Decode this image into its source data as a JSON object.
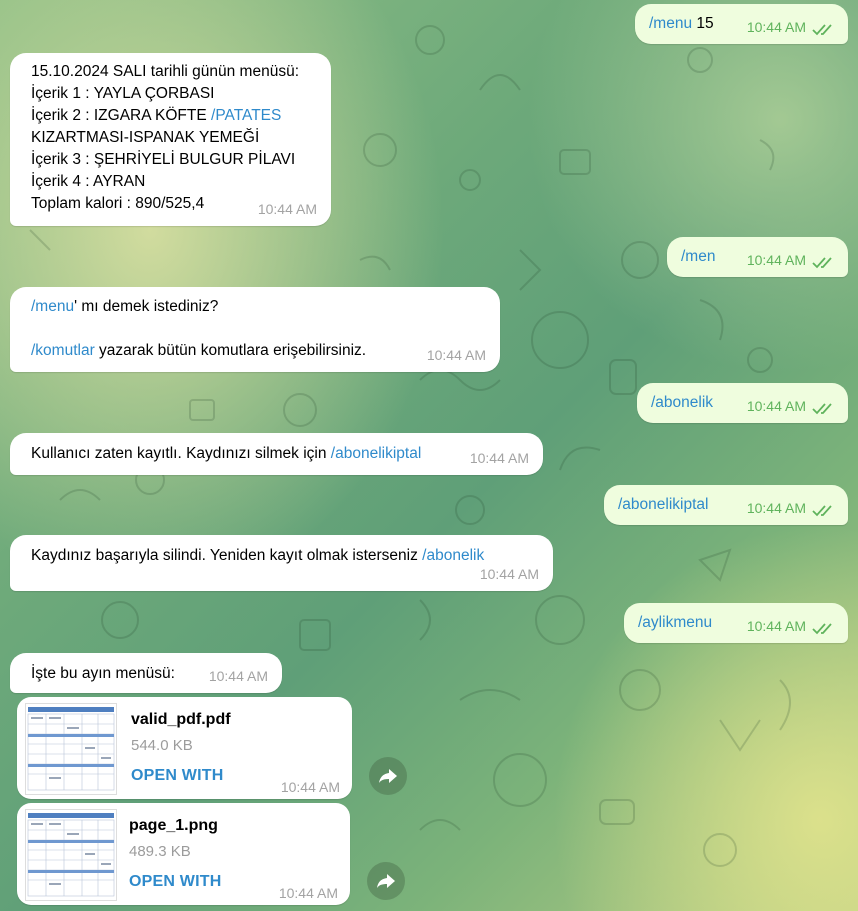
{
  "colors": {
    "link": "#2f8acb",
    "outgoing_bubble": "#effdde",
    "incoming_bubble": "#ffffff",
    "read_ticks": "#5fb35c"
  },
  "messages": [
    {
      "dir": "out",
      "cmd": "/menu",
      "rest": " 15",
      "time": "10:44 AM"
    },
    {
      "dir": "in",
      "lines": [
        "15.10.2024 SALI tarihli günün menüsü:",
        "İçerik 1 : YAYLA ÇORBASI"
      ],
      "line3a": "İçerik 2 : IZGARA KÖFTE ",
      "line3link": "/PATATES",
      "lines2": [
        "KIZARTMASI-ISPANAK YEMEĞİ",
        "İçerik 3 : ŞEHRİYELİ BULGUR PİLAVI",
        "İçerik 4 : AYRAN"
      ],
      "last": "Toplam kalori : 890/525,4",
      "time": "10:44 AM"
    },
    {
      "dir": "out",
      "cmd": "/men",
      "time": "10:44 AM"
    },
    {
      "dir": "in",
      "cmd1": "/menu",
      "rest1": "' mı demek istediniz?",
      "cmd2": "/komutlar",
      "rest2": " yazarak bütün komutlara erişebilirsiniz.",
      "time": "10:44 AM"
    },
    {
      "dir": "out",
      "cmd": "/abonelik",
      "time": "10:44 AM"
    },
    {
      "dir": "in",
      "text": "Kullanıcı zaten kayıtlı. Kaydınızı silmek için ",
      "cmd": "/abonelikiptal",
      "time": "10:44 AM"
    },
    {
      "dir": "out",
      "cmd": "/abonelikiptal",
      "time": "10:44 AM"
    },
    {
      "dir": "in",
      "text": "Kaydınız başarıyla silindi. Yeniden kayıt olmak isterseniz ",
      "cmd": "/abonelik",
      "time": "10:44 AM"
    },
    {
      "dir": "out",
      "cmd": "/aylikmenu",
      "time": "10:44 AM"
    },
    {
      "dir": "in",
      "text": "İşte bu ayın menüsü:",
      "time": "10:44 AM"
    }
  ],
  "files": [
    {
      "name": "valid_pdf.pdf",
      "size": "544.0 KB",
      "action": "OPEN WITH",
      "time": "10:44 AM",
      "icon": "share-icon"
    },
    {
      "name": "page_1.png",
      "size": "489.3 KB",
      "action": "OPEN WITH",
      "time": "10:44 AM",
      "icon": "share-icon"
    }
  ]
}
